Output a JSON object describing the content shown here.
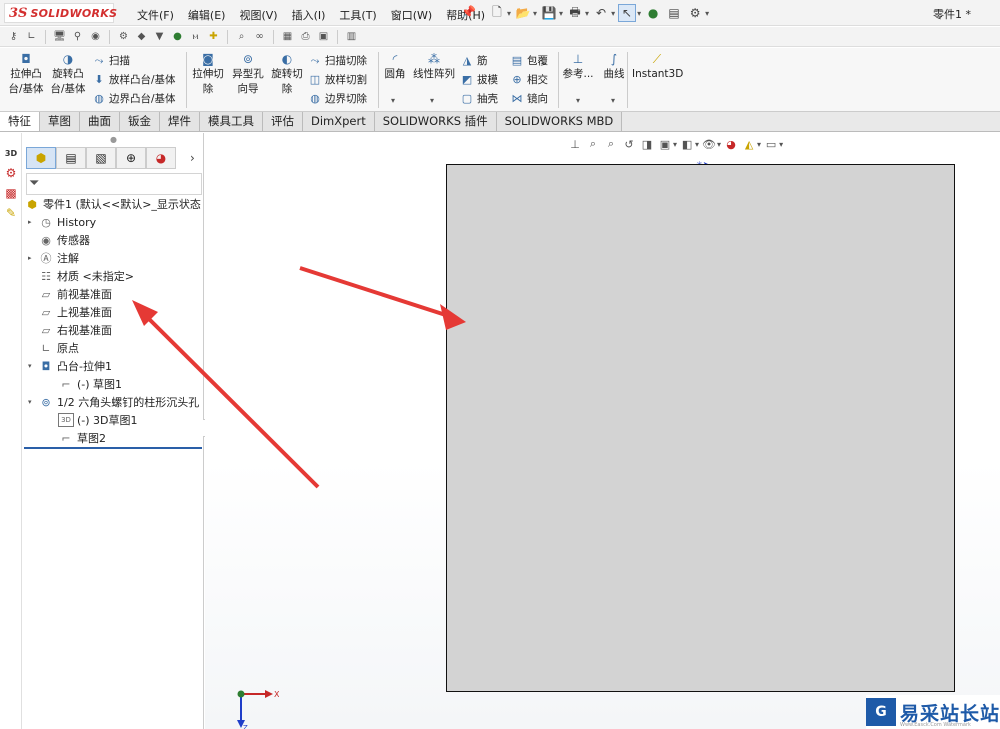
{
  "app": {
    "logo_ds": "3S",
    "logo_brand": "SOLIDWORKS",
    "doc_title": "零件1 *"
  },
  "menu": [
    "文件(F)",
    "编辑(E)",
    "视图(V)",
    "插入(I)",
    "工具(T)",
    "窗口(W)",
    "帮助(H)"
  ],
  "command_manager": {
    "extrude_boss": "拉伸凸\n台/基体",
    "revolve_boss": "旋转凸\n台/基体",
    "sweep": "扫描",
    "loft_boss": "放样凸台/基体",
    "boundary_boss": "边界凸台/基体",
    "extrude_cut": "拉伸切\n除",
    "hole_wizard": "异型孔\n向导",
    "revolve_cut": "旋转切\n除",
    "sweep_cut": "扫描切除",
    "loft_cut": "放样切割",
    "boundary_cut": "边界切除",
    "fillet": "圆角",
    "linear_pattern": "线性阵列",
    "rib": "筋",
    "draft": "拔模",
    "shell": "抽壳",
    "wrap": "包覆",
    "intersect": "相交",
    "mirror": "镜向",
    "reference": "参考...",
    "curves": "曲线",
    "instant3d": "Instant3D"
  },
  "tabs": [
    "特征",
    "草图",
    "曲面",
    "钣金",
    "焊件",
    "模具工具",
    "评估",
    "DimXpert",
    "SOLIDWORKS 插件",
    "SOLIDWORKS MBD"
  ],
  "active_tab": "特征",
  "feature_tree": {
    "root": "零件1  (默认<<默认>_显示状态",
    "items": [
      {
        "label": "History",
        "icon": "history-icon",
        "expandable": true
      },
      {
        "label": "传感器",
        "icon": "sensor-icon",
        "expandable": false
      },
      {
        "label": "注解",
        "icon": "annotation-icon",
        "expandable": true
      },
      {
        "label": "材质 <未指定>",
        "icon": "material-icon",
        "expandable": false
      },
      {
        "label": "前视基准面",
        "icon": "plane-icon",
        "expandable": false
      },
      {
        "label": "上视基准面",
        "icon": "plane-icon",
        "expandable": false
      },
      {
        "label": "右视基准面",
        "icon": "plane-icon",
        "expandable": false
      },
      {
        "label": "原点",
        "icon": "origin-icon",
        "expandable": false
      },
      {
        "label": "凸台-拉伸1",
        "icon": "boss-extrude-icon",
        "expanded": true
      },
      {
        "label": "(-) 草图1",
        "icon": "sketch-icon",
        "child": true
      },
      {
        "label": "1/2 六角头螺钉的柱形沉头孔",
        "icon": "hole-icon",
        "expanded": true
      },
      {
        "label": "(-) 3D草图1",
        "icon": "3d-sketch-icon",
        "child": true
      },
      {
        "label": "草图2",
        "icon": "sketch-icon",
        "child": true
      }
    ]
  },
  "left_strip": {
    "label_3d": "3D"
  },
  "triad": {
    "x": "X",
    "z": "Z"
  },
  "watermark": {
    "text": "易采站长站",
    "url": "Www.Easck.Com Watermark"
  }
}
